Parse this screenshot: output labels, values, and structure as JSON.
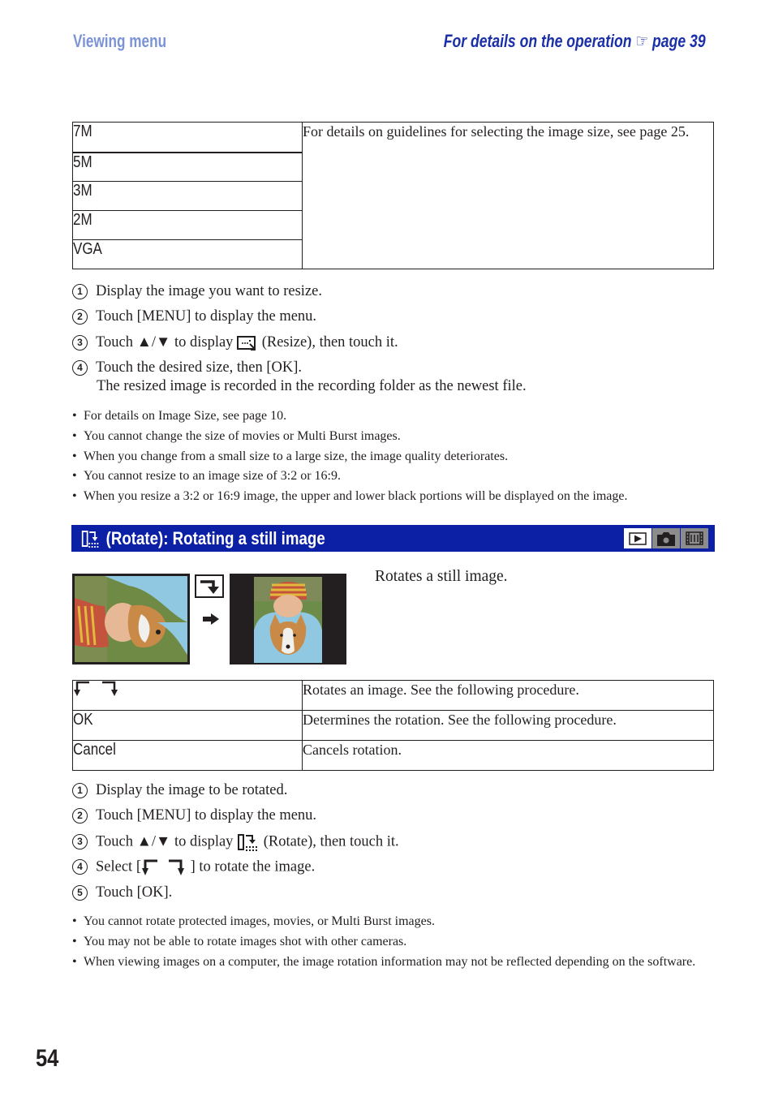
{
  "header": {
    "section": "Viewing menu",
    "reference": "For details on the operation",
    "reference_icon": "pointing-hand-icon",
    "reference_page": "page 39"
  },
  "resize_table": {
    "sizes": [
      "7M",
      "5M",
      "3M",
      "2M",
      "VGA"
    ],
    "description": "For details on guidelines for selecting the image size, see page 25."
  },
  "resize_steps": [
    {
      "num": "1",
      "text": "Display the image you want to resize."
    },
    {
      "num": "2",
      "text": "Touch [MENU] to display the menu."
    },
    {
      "num": "3",
      "pre": "Touch ▲/▼ to display",
      "icon": "resize-icon",
      "post": "(Resize), then touch it."
    },
    {
      "num": "4",
      "text": "Touch the desired size, then [OK].",
      "continuation": "The resized image is recorded in the recording folder as the newest file."
    }
  ],
  "resize_notes": [
    "For details on Image Size, see page 10.",
    "You cannot change the size of movies or Multi Burst images.",
    "When you change from a small size to a large size, the image quality deteriorates.",
    "You cannot resize to an image size of 3:2 or 16:9.",
    "When you resize a 3:2 or 16:9 image, the upper and lower black portions will be displayed on the image."
  ],
  "rotate_section": {
    "icon": "rotate-icon",
    "title": "(Rotate): Rotating a still image",
    "mode_icons": [
      {
        "name": "playback-mode-icon",
        "active": true
      },
      {
        "name": "camera-mode-icon",
        "active": false
      },
      {
        "name": "movie-mode-icon",
        "active": false
      }
    ],
    "intro": "Rotates a still image.",
    "illustration": {
      "before": "Photo of girl with knit hat holding a corgi, rotated sideways",
      "rotate_icon": "rotate-clockwise-icon",
      "arrow": "right-arrow-icon",
      "after": "Same photo displayed upright with black side bars"
    }
  },
  "rotate_table": [
    {
      "label_icon": "rotate-left-right-icons",
      "description": "Rotates an image. See the following procedure."
    },
    {
      "label": "OK",
      "description": "Determines the rotation. See the following procedure."
    },
    {
      "label": "Cancel",
      "description": "Cancels rotation."
    }
  ],
  "rotate_steps": [
    {
      "num": "1",
      "text": "Display the image to be rotated."
    },
    {
      "num": "2",
      "text": "Touch [MENU] to display the menu."
    },
    {
      "num": "3",
      "pre": "Touch ▲/▼ to display",
      "icon": "rotate-icon",
      "post": "(Rotate), then touch it."
    },
    {
      "num": "4",
      "pre": "Select [",
      "icon": "rotate-left-right-icons",
      "post": "] to rotate the image."
    },
    {
      "num": "5",
      "text": "Touch [OK]."
    }
  ],
  "rotate_notes": [
    "You cannot rotate protected images, movies, or Multi Burst images.",
    "You may not be able to rotate images shot with other cameras.",
    "When viewing images on a computer, the image rotation information may not be reflected depending on the software."
  ],
  "page_number": "54",
  "colors": {
    "header_section": "#7b93d6",
    "header_reference": "#1a2fa8",
    "section_bar": "#0c20a6"
  }
}
